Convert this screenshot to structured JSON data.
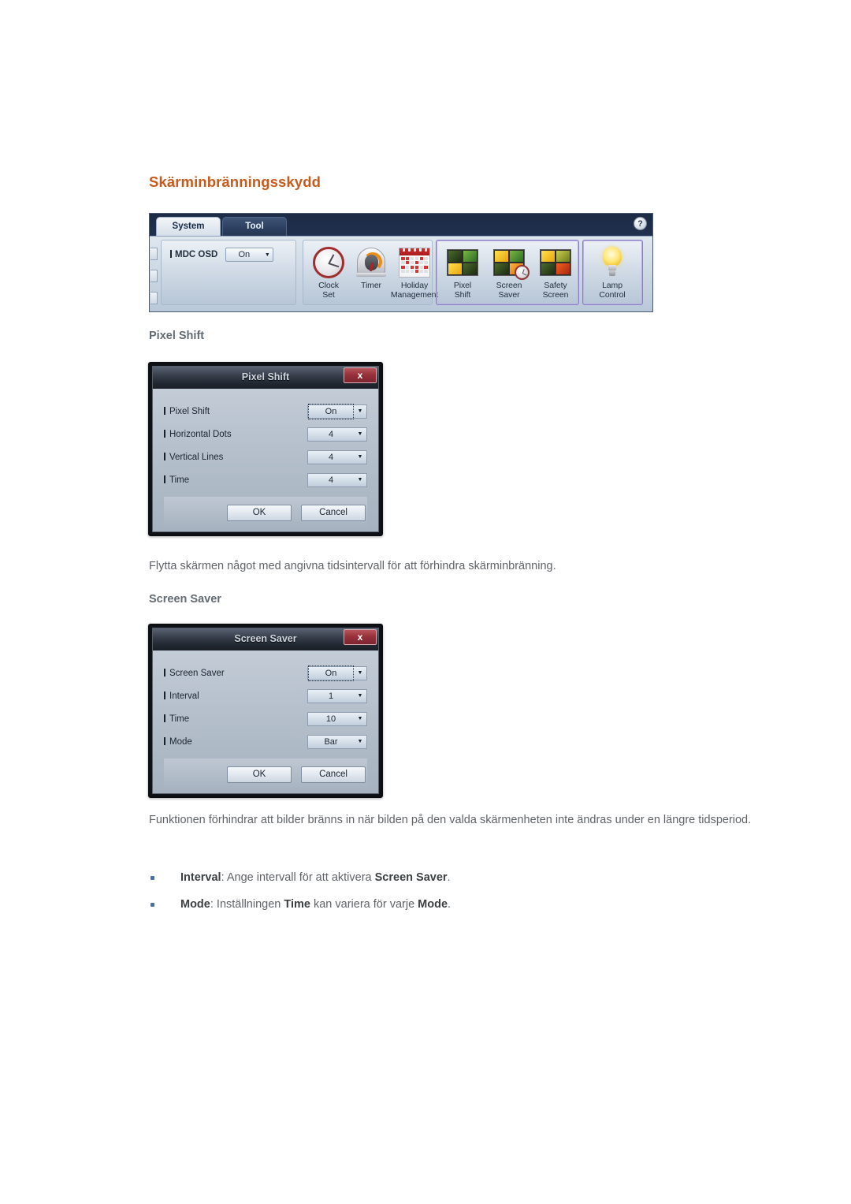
{
  "section": {
    "title": "Skärminbränningsskydd"
  },
  "ribbon": {
    "tabs": [
      {
        "label": "System",
        "active": true
      },
      {
        "label": "Tool",
        "active": false
      }
    ],
    "help_label": "?",
    "osd": {
      "label": "MDC OSD",
      "value": "On",
      "arrow": "▼"
    },
    "groups": [
      {
        "name": "clock-group",
        "tiles": [
          {
            "line1": "Clock",
            "line2": "Set",
            "icon": "clock-icon"
          },
          {
            "line1": "Timer",
            "line2": "",
            "icon": "timer-icon"
          },
          {
            "line1": "Holiday",
            "line2": "Management",
            "icon": "calendar-icon"
          }
        ]
      },
      {
        "name": "pixel-group",
        "highlighted": true,
        "tiles": [
          {
            "line1": "Pixel",
            "line2": "Shift",
            "icon": "pixel-shift-icon"
          },
          {
            "line1": "Screen",
            "line2": "Saver",
            "icon": "screen-saver-icon"
          },
          {
            "line1": "Safety",
            "line2": "Screen",
            "icon": "safety-screen-icon"
          }
        ]
      },
      {
        "name": "lamp-group",
        "highlighted": true,
        "tiles": [
          {
            "line1": "Lamp",
            "line2": "Control",
            "icon": "lightbulb-icon"
          }
        ]
      }
    ]
  },
  "pixel_shift": {
    "heading": "Pixel Shift",
    "dialog": {
      "title": "Pixel Shift",
      "close_label": "x",
      "fields": [
        {
          "label": "Pixel Shift",
          "value": "On",
          "focused": true
        },
        {
          "label": "Horizontal Dots",
          "value": "4",
          "focused": false
        },
        {
          "label": "Vertical Lines",
          "value": "4",
          "focused": false
        },
        {
          "label": "Time",
          "value": "4",
          "focused": false
        }
      ],
      "ok_label": "OK",
      "cancel_label": "Cancel",
      "arrow": "▼"
    },
    "description": "Flytta skärmen något med angivna tidsintervall för att förhindra skärminbränning."
  },
  "screen_saver": {
    "heading": "Screen Saver",
    "dialog": {
      "title": "Screen Saver",
      "close_label": "x",
      "fields": [
        {
          "label": "Screen Saver",
          "value": "On",
          "focused": true
        },
        {
          "label": "Interval",
          "value": "1",
          "focused": false
        },
        {
          "label": "Time",
          "value": "10",
          "focused": false
        },
        {
          "label": "Mode",
          "value": "Bar",
          "focused": false
        }
      ],
      "ok_label": "OK",
      "cancel_label": "Cancel",
      "arrow": "▼"
    },
    "description": "Funktionen förhindrar att bilder bränns in när bilden på den valda skärmenheten inte ändras under en längre tidsperiod.",
    "bullets": [
      {
        "parts": [
          {
            "text": "Interval",
            "bold": true
          },
          {
            "text": ": Ange intervall för att aktivera ",
            "bold": false
          },
          {
            "text": "Screen Saver",
            "bold": true
          },
          {
            "text": ".",
            "bold": false
          }
        ]
      },
      {
        "parts": [
          {
            "text": "Mode",
            "bold": true
          },
          {
            "text": ": Inställningen ",
            "bold": false
          },
          {
            "text": "Time",
            "bold": true
          },
          {
            "text": " kan variera för varje ",
            "bold": false
          },
          {
            "text": "Mode",
            "bold": true
          },
          {
            "text": ".",
            "bold": false
          }
        ]
      }
    ]
  },
  "colors": {
    "section_title": "#c75b1e",
    "heading": "#636b72",
    "body_text": "#5f6368",
    "bullet_dot": "#4472a8",
    "highlight_border": "#8a7ec8",
    "close_button": "#97323c"
  }
}
